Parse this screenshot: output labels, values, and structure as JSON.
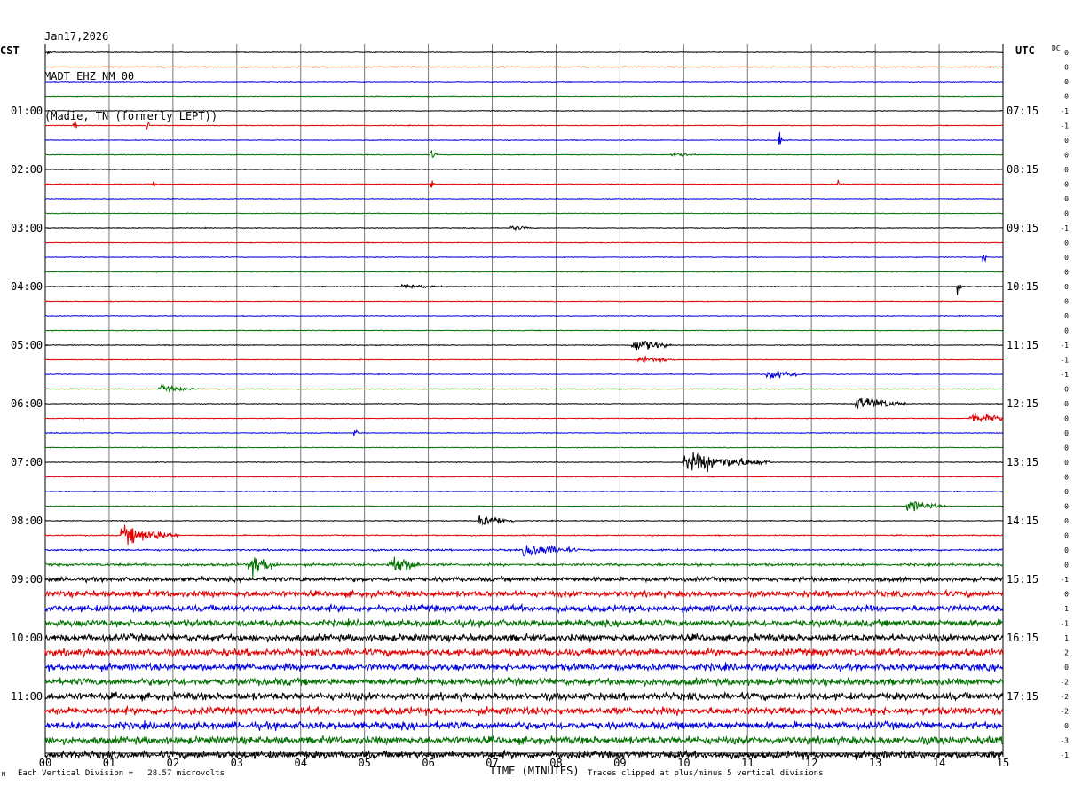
{
  "header": {
    "date": "Jan17,2026",
    "station": "MADT EHZ NM 00",
    "location": "(Madie, TN (formerly LEPT))"
  },
  "left_tz": "CST",
  "right_tz": "UTC",
  "dc_label": "DC",
  "footer": {
    "scale": "Each Vertical Division =   28.57 microvolts",
    "clip": "Traces clipped at plus/minus 5 vertical divisions",
    "mark": "M"
  },
  "chart_data": {
    "type": "line",
    "title": "",
    "xlabel": "TIME (MINUTES)",
    "xlim": [
      0,
      15
    ],
    "x_ticks": [
      "00",
      "01",
      "02",
      "03",
      "04",
      "05",
      "06",
      "07",
      "08",
      "09",
      "10",
      "11",
      "12",
      "13",
      "14",
      "15"
    ],
    "rows_per_hour": 4,
    "minutes_per_row": 15,
    "trace_colors": [
      "#000000",
      "#e00000",
      "#0000e0",
      "#007000"
    ],
    "left_time_labels": [
      "01:00",
      "02:00",
      "03:00",
      "04:00",
      "05:00",
      "06:00",
      "07:00",
      "08:00",
      "09:00",
      "10:00",
      "11:00"
    ],
    "left_label_rows": [
      4,
      8,
      12,
      16,
      20,
      24,
      28,
      32,
      36,
      40,
      44
    ],
    "right_time_labels": [
      "07:15",
      "08:15",
      "09:15",
      "10:15",
      "11:15",
      "12:15",
      "13:15",
      "14:15",
      "15:15",
      "16:15",
      "17:15"
    ],
    "right_label_rows": [
      4,
      8,
      12,
      16,
      20,
      24,
      28,
      32,
      36,
      40,
      44
    ],
    "dc_offsets": [
      "0",
      "0",
      "0",
      "0",
      "-1",
      "-1",
      "0",
      "0",
      "0",
      "0",
      "0",
      "0",
      "-1",
      "0",
      "0",
      "0",
      "0",
      "0",
      "0",
      "0",
      "-1",
      "-1",
      "-1",
      "0",
      "0",
      "0",
      "0",
      "0",
      "0",
      "0",
      "0",
      "0",
      "0",
      "0",
      "0",
      "0",
      "-1",
      "0",
      "-1",
      "-1",
      "1",
      "2",
      "0",
      "-2",
      "-2",
      "-2",
      "0",
      "-3",
      "-1"
    ],
    "noise_levels": [
      0.35,
      0.35,
      0.35,
      0.35,
      0.35,
      0.35,
      0.35,
      0.35,
      0.35,
      0.35,
      0.35,
      0.35,
      0.35,
      0.35,
      0.35,
      0.35,
      0.35,
      0.35,
      0.35,
      0.35,
      0.35,
      0.35,
      0.35,
      0.35,
      0.35,
      0.35,
      0.35,
      0.35,
      0.35,
      0.35,
      0.35,
      0.35,
      0.4,
      0.5,
      0.8,
      1.1,
      2.0,
      2.8,
      3.0,
      3.0,
      3.2,
      3.2,
      3.2,
      3.2,
      3.4,
      3.4,
      3.4,
      3.4,
      3.4
    ],
    "events": [
      {
        "row": 0,
        "minute": 0.05,
        "duration": 0.1,
        "amplitude": 2
      },
      {
        "row": 5,
        "minute": 0.45,
        "duration": 0.05,
        "amplitude": 10
      },
      {
        "row": 5,
        "minute": 1.6,
        "duration": 0.05,
        "amplitude": 4
      },
      {
        "row": 6,
        "minute": 11.5,
        "duration": 0.05,
        "amplitude": 12
      },
      {
        "row": 7,
        "minute": 6.05,
        "duration": 0.1,
        "amplitude": 4
      },
      {
        "row": 7,
        "minute": 9.8,
        "duration": 0.5,
        "amplitude": 2
      },
      {
        "row": 9,
        "minute": 1.7,
        "duration": 0.05,
        "amplitude": 4
      },
      {
        "row": 9,
        "minute": 6.05,
        "duration": 0.05,
        "amplitude": 6
      },
      {
        "row": 9,
        "minute": 12.4,
        "duration": 0.05,
        "amplitude": 4
      },
      {
        "row": 12,
        "minute": 7.3,
        "duration": 0.4,
        "amplitude": 2
      },
      {
        "row": 14,
        "minute": 14.7,
        "duration": 0.05,
        "amplitude": 6
      },
      {
        "row": 16,
        "minute": 5.6,
        "duration": 0.8,
        "amplitude": 2
      },
      {
        "row": 16,
        "minute": 14.3,
        "duration": 0.05,
        "amplitude": 6
      },
      {
        "row": 20,
        "minute": 9.2,
        "duration": 0.6,
        "amplitude": 6
      },
      {
        "row": 21,
        "minute": 9.3,
        "duration": 0.6,
        "amplitude": 3
      },
      {
        "row": 22,
        "minute": 11.3,
        "duration": 0.6,
        "amplitude": 5
      },
      {
        "row": 23,
        "minute": 1.8,
        "duration": 0.6,
        "amplitude": 3
      },
      {
        "row": 24,
        "minute": 12.7,
        "duration": 0.8,
        "amplitude": 6
      },
      {
        "row": 25,
        "minute": 14.5,
        "duration": 0.8,
        "amplitude": 4
      },
      {
        "row": 26,
        "minute": 4.85,
        "duration": 0.05,
        "amplitude": 6
      },
      {
        "row": 28,
        "minute": 10.0,
        "duration": 1.4,
        "amplitude": 8
      },
      {
        "row": 31,
        "minute": 13.5,
        "duration": 0.6,
        "amplitude": 5
      },
      {
        "row": 32,
        "minute": 6.8,
        "duration": 0.6,
        "amplitude": 5
      },
      {
        "row": 33,
        "minute": 1.2,
        "duration": 0.9,
        "amplitude": 8
      },
      {
        "row": 34,
        "minute": 7.5,
        "duration": 0.9,
        "amplitude": 6
      },
      {
        "row": 35,
        "minute": 3.2,
        "duration": 0.5,
        "amplitude": 9
      },
      {
        "row": 35,
        "minute": 5.4,
        "duration": 0.5,
        "amplitude": 10
      }
    ]
  }
}
